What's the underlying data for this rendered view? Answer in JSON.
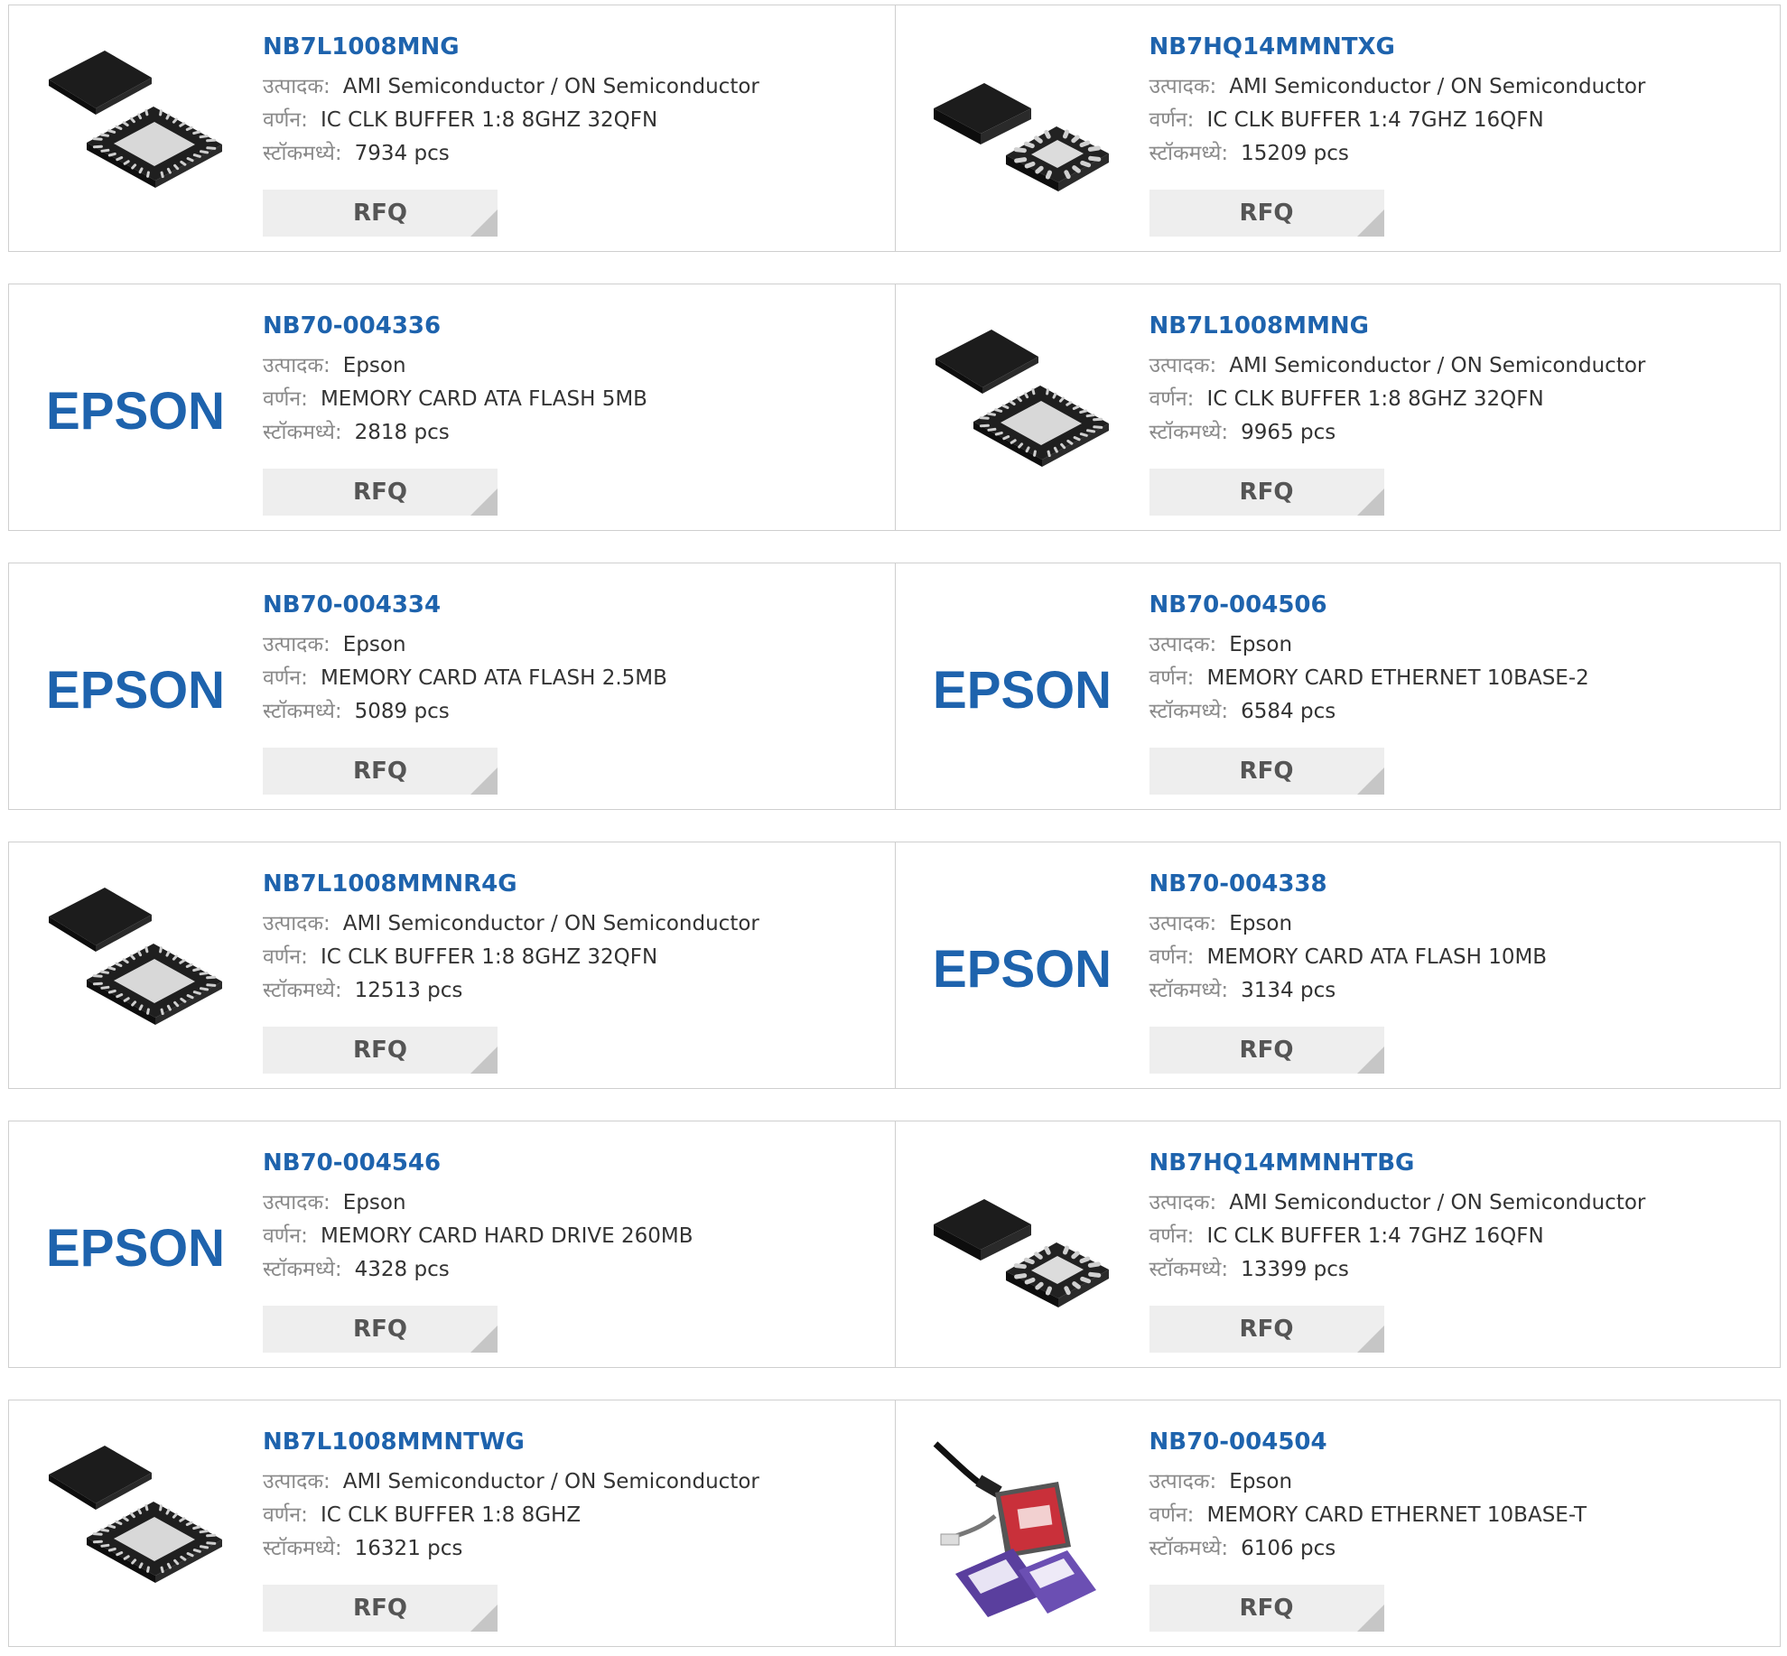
{
  "labels": {
    "manufacturer": "उत्पादक:",
    "description": "वर्णन:",
    "stock": "स्टॉकमध्ये:",
    "rfq": "RFQ"
  },
  "brand_color": "#1e63ad",
  "rows": [
    [
      {
        "part": "NB7L1008MNG",
        "image": "qfn32-chip-icon",
        "manufacturer": "AMI Semiconductor / ON Semiconductor",
        "description": "IC CLK BUFFER 1:8 8GHZ 32QFN",
        "stock": "7934 pcs"
      },
      {
        "part": "NB7HQ14MMNTXG",
        "image": "qfn16-chip-icon",
        "manufacturer": "AMI Semiconductor / ON Semiconductor",
        "description": "IC CLK BUFFER 1:4 7GHZ 16QFN",
        "stock": "15209 pcs"
      }
    ],
    [
      {
        "part": "NB70-004336",
        "image": "epson-logo",
        "logo_text": "EPSON",
        "manufacturer": "Epson",
        "description": "MEMORY CARD ATA FLASH 5MB",
        "stock": "2818 pcs"
      },
      {
        "part": "NB7L1008MMNG",
        "image": "qfn32-chip-icon",
        "manufacturer": "AMI Semiconductor / ON Semiconductor",
        "description": "IC CLK BUFFER 1:8 8GHZ 32QFN",
        "stock": "9965 pcs"
      }
    ],
    [
      {
        "part": "NB70-004334",
        "image": "epson-logo",
        "logo_text": "EPSON",
        "manufacturer": "Epson",
        "description": "MEMORY CARD ATA FLASH 2.5MB",
        "stock": "5089 pcs"
      },
      {
        "part": "NB70-004506",
        "image": "epson-logo",
        "logo_text": "EPSON",
        "manufacturer": "Epson",
        "description": "MEMORY CARD ETHERNET 10BASE-2",
        "stock": "6584 pcs"
      }
    ],
    [
      {
        "part": "NB7L1008MMNR4G",
        "image": "qfn32-chip-icon",
        "manufacturer": "AMI Semiconductor / ON Semiconductor",
        "description": "IC CLK BUFFER 1:8 8GHZ 32QFN",
        "stock": "12513 pcs"
      },
      {
        "part": "NB70-004338",
        "image": "epson-logo",
        "logo_text": "EPSON",
        "manufacturer": "Epson",
        "description": "MEMORY CARD ATA FLASH 10MB",
        "stock": "3134 pcs"
      }
    ],
    [
      {
        "part": "NB70-004546",
        "image": "epson-logo",
        "logo_text": "EPSON",
        "manufacturer": "Epson",
        "description": "MEMORY CARD HARD DRIVE 260MB",
        "stock": "4328 pcs"
      },
      {
        "part": "NB7HQ14MMNHTBG",
        "image": "qfn16-chip-icon",
        "manufacturer": "AMI Semiconductor / ON Semiconductor",
        "description": "IC CLK BUFFER 1:4 7GHZ 16QFN",
        "stock": "13399 pcs"
      }
    ],
    [
      {
        "part": "NB7L1008MMNTWG",
        "image": "qfn32-chip-icon",
        "manufacturer": "AMI Semiconductor / ON Semiconductor",
        "description": "IC CLK BUFFER 1:8 8GHZ",
        "stock": "16321 pcs"
      },
      {
        "part": "NB70-004504",
        "image": "pc-card-kit-icon",
        "manufacturer": "Epson",
        "description": "MEMORY CARD ETHERNET 10BASE-T",
        "stock": "6106 pcs"
      }
    ]
  ]
}
